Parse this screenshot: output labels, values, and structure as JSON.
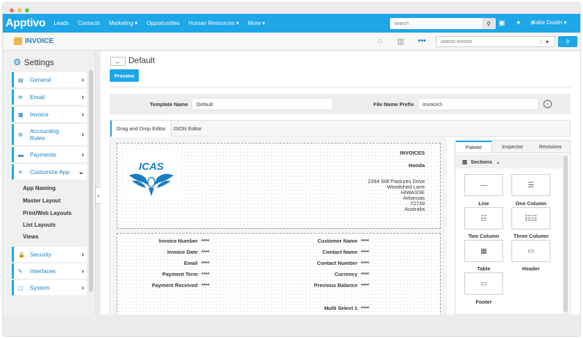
{
  "window": {
    "dot_colors": [
      "#ef6b5c",
      "#f5bf4f",
      "#5fc454"
    ]
  },
  "colors": {
    "accent": "#1da6e8",
    "link": "#1a7fc1"
  },
  "topnav": {
    "logo": "Apptivo",
    "items": [
      {
        "label": "Leads"
      },
      {
        "label": "Contacts"
      },
      {
        "label": "Marketing ▾"
      },
      {
        "label": "Opportunities"
      },
      {
        "label": "Human Resources ▾"
      },
      {
        "label": "More ▾"
      }
    ],
    "search_placeholder": "search",
    "user": "Katie Dustin ▾"
  },
  "subbar": {
    "title": "INVOICE",
    "search_placeholder": "search Invoice"
  },
  "sidebar": {
    "title": "Settings",
    "items": [
      {
        "label": "General",
        "icon": "general-icon",
        "glyph": "▤"
      },
      {
        "label": "Email",
        "icon": "email-icon",
        "glyph": "✉"
      },
      {
        "label": "Invoice",
        "icon": "invoice-icon",
        "glyph": "▦"
      },
      {
        "label": "Accounting Rules",
        "icon": "accounting-rules-icon",
        "glyph": "⚙"
      },
      {
        "label": "Payments",
        "icon": "payments-icon",
        "glyph": "▬"
      },
      {
        "label": "Customize App",
        "icon": "customize-app-icon",
        "glyph": "✕"
      },
      {
        "label": "Security",
        "icon": "lock-icon",
        "glyph": "🔒"
      },
      {
        "label": "Interfaces",
        "icon": "interfaces-icon",
        "glyph": "✎"
      },
      {
        "label": "System",
        "icon": "system-icon",
        "glyph": "▢"
      }
    ],
    "sub_items": [
      {
        "label": "App Naming"
      },
      {
        "label": "Master Layout"
      },
      {
        "label": "Print/Web Layouts"
      },
      {
        "label": "List Layouts"
      },
      {
        "label": "Views"
      }
    ]
  },
  "main": {
    "title": "Default",
    "preview_label": "Preview",
    "template_name_label": "Template Name",
    "template_name_value": "Default",
    "file_prefix_label": "File Name Prefix",
    "file_prefix_value": "invoice2-",
    "tabs": [
      {
        "label": "Drag and Drop Editor"
      },
      {
        "label": "JSON Editor"
      }
    ]
  },
  "invoice_header": {
    "title": "INVOICES",
    "company": "Honda",
    "address": [
      "2394 Still Pastures Drive",
      "Woodshed Lane",
      "HIWASSE",
      "Arkansas",
      "72739",
      "Australia"
    ],
    "logo_text": "ICAS"
  },
  "invoice_fields": {
    "left": [
      {
        "label": "Invoice Number",
        "value": "****"
      },
      {
        "label": "Invoice Date",
        "value": "****"
      },
      {
        "label": "Email",
        "value": "****"
      },
      {
        "label": "Payment Term",
        "value": "****"
      },
      {
        "label": "Payment Received",
        "value": "****"
      }
    ],
    "right": [
      {
        "label": "Customer Name",
        "value": "****"
      },
      {
        "label": "Contact Name",
        "value": "****"
      },
      {
        "label": "Contact Number",
        "value": "****"
      },
      {
        "label": "Currency",
        "value": "****"
      },
      {
        "label": "Previous Balance",
        "value": "****"
      },
      {
        "label": "Multi Select 1",
        "value": "****"
      }
    ]
  },
  "palette": {
    "tabs": [
      {
        "label": "Palette"
      },
      {
        "label": "Inspector"
      },
      {
        "label": "Revisions"
      }
    ],
    "sections_label": "Sections",
    "tiles": [
      {
        "label": "Line",
        "glyph": "—"
      },
      {
        "label": "One Column",
        "glyph": "☰"
      },
      {
        "label": "Two Column",
        "glyph": "☷"
      },
      {
        "label": "Three Column",
        "glyph": "☷☷"
      },
      {
        "label": "Table",
        "glyph": "▦"
      },
      {
        "label": "Header",
        "glyph": "▭"
      },
      {
        "label": "Footer",
        "glyph": "▭"
      }
    ]
  }
}
